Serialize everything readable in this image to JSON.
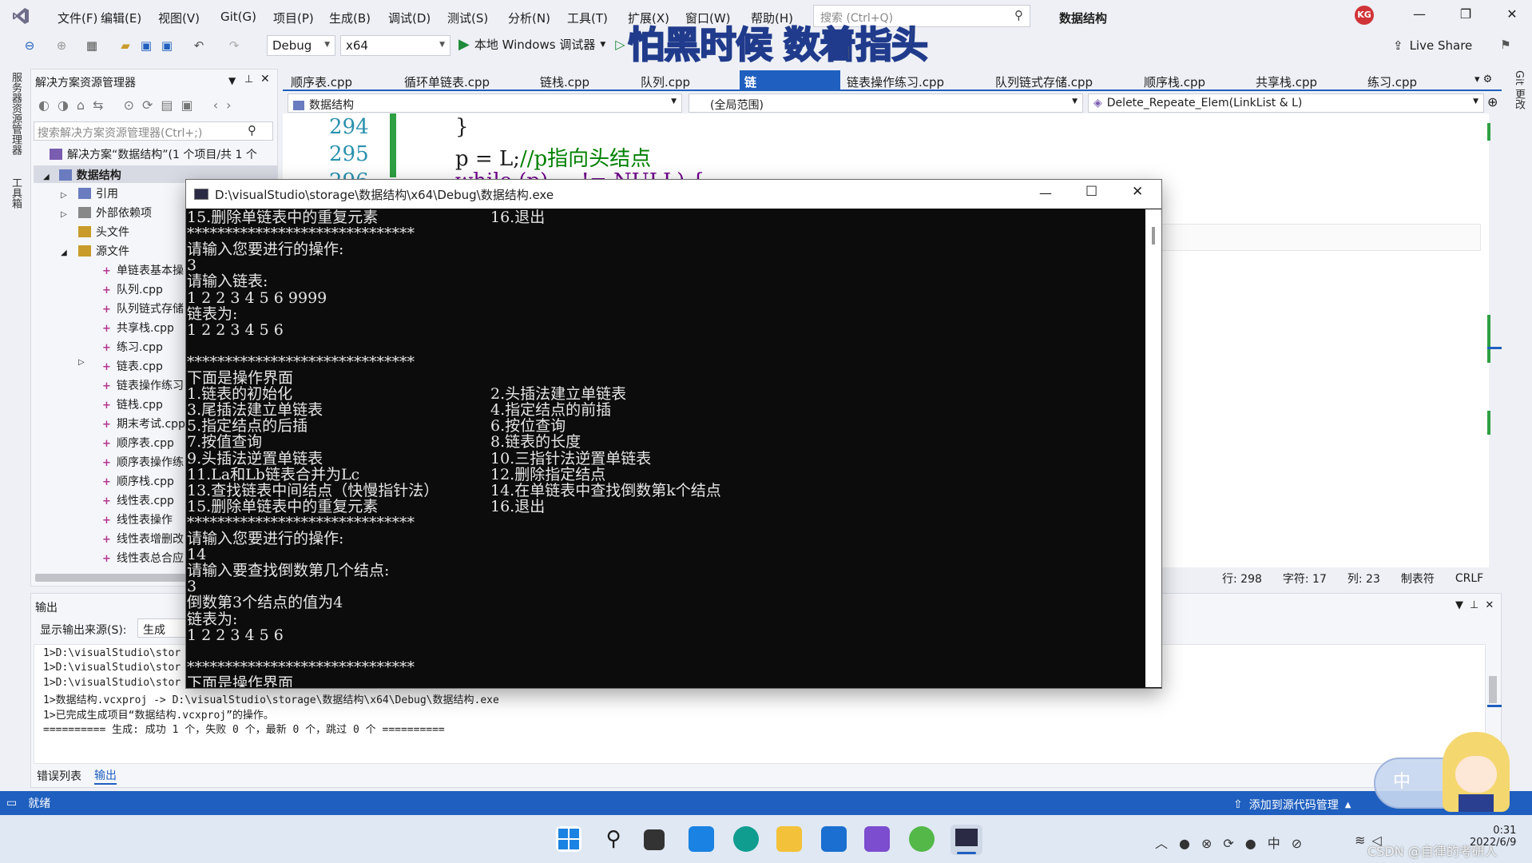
{
  "menubar": {
    "items": [
      "文件(F)",
      "编辑(E)",
      "视图(V)",
      "Git(G)",
      "项目(P)",
      "生成(B)",
      "调试(D)",
      "测试(S)",
      "分析(N)",
      "工具(T)",
      "扩展(X)",
      "窗口(W)",
      "帮助(H)"
    ],
    "search_placeholder": "搜索 (Ctrl+Q)",
    "app_title": "数据结构",
    "avatar": "KG"
  },
  "toolbar": {
    "config": "Debug",
    "platform": "x64",
    "run_label": "本地 Windows 调试器",
    "live_share": "Live Share"
  },
  "watermark": "怕黑时候 数着指头",
  "left_strip": [
    "服务器资源管理器",
    "工具箱"
  ],
  "right_strip": [
    "Git 更改"
  ],
  "solution_explorer": {
    "title": "解决方案资源管理器",
    "search_placeholder": "搜索解决方案资源管理器(Ctrl+;)",
    "solution": "解决方案“数据结构”(1 个项目/共 1 个",
    "project": "数据结构",
    "nodes": [
      "引用",
      "外部依赖项",
      "头文件",
      "源文件"
    ],
    "files": [
      "单链表基本操",
      "队列.cpp",
      "队列链式存储",
      "共享栈.cpp",
      "练习.cpp",
      "链表.cpp",
      "链表操作练习",
      "链栈.cpp",
      "期末考试.cpp",
      "顺序表.cpp",
      "顺序表操作练",
      "顺序栈.cpp",
      "线性表.cpp",
      "线性表操作",
      "线性表增删改",
      "线性表总合应"
    ]
  },
  "editor": {
    "tabs": [
      "顺序表.cpp",
      "循环单链表.cpp",
      "链栈.cpp",
      "队列.cpp",
      "链表.cpp*",
      "链表操作练习.cpp",
      "队列链式存储.cpp",
      "顺序栈.cpp",
      "共享栈.cpp",
      "练习.cpp"
    ],
    "active_tab": "链表.cpp*",
    "nav_project": "数据结构",
    "nav_scope": "(全局范围)",
    "nav_function": "Delete_Repeate_Elem(LinkList & L)",
    "line_numbers": [
      "294",
      "295",
      "296"
    ],
    "code_line_294": "}",
    "code_line_295_code": "p = L;",
    "code_line_295_comment": "//p指向头结点",
    "code_line_296": "while (p) ... != NULL) {",
    "status": {
      "line": "行: 298",
      "char": "字符: 17",
      "col": "列: 23",
      "tab": "制表符",
      "eol": "CRLF"
    }
  },
  "output_panel": {
    "title": "输出",
    "source_label": "显示输出来源(S):",
    "source_value": "生成",
    "lines": [
      "1>D:\\visualStudio\\stor",
      "1>D:\\visualStudio\\stor",
      "1>D:\\visualStudio\\stor",
      "1>数据结构.vcxproj -> D:\\visualStudio\\storage\\数据结构\\x64\\Debug\\数据结构.exe",
      "1>已完成生成项目“数据结构.vcxproj”的操作。",
      "========== 生成: 成功 1 个，失败 0 个，最新 0 个，跳过 0 个 =========="
    ],
    "bottom_tabs": [
      "错误列表",
      "输出"
    ]
  },
  "statusbar": {
    "ready": "就绪",
    "source_control": "添加到源代码管理"
  },
  "console": {
    "title": "D:\\visualStudio\\storage\\数据结构\\x64\\Debug\\数据结构.exe",
    "lines": [
      {
        "l": "15.删除单链表中的重复元素",
        "r": "16.退出"
      },
      {
        "l": "******************************"
      },
      {
        "l": "请输入您要进行的操作:"
      },
      {
        "l": "3"
      },
      {
        "l": "请输入链表:"
      },
      {
        "l": "1 2 2 3 4 5 6 9999"
      },
      {
        "l": "链表为:"
      },
      {
        "l": "1 2 2 3 4 5 6"
      },
      {
        "l": ""
      },
      {
        "l": "******************************"
      },
      {
        "l": "下面是操作界面"
      },
      {
        "l": "1.链表的初始化",
        "r": "2.头插法建立单链表"
      },
      {
        "l": "3.尾插法建立单链表",
        "r": "4.指定结点的前插"
      },
      {
        "l": "5.指定结点的后插",
        "r": "6.按位查询"
      },
      {
        "l": "7.按值查询",
        "r": "8.链表的长度"
      },
      {
        "l": "9.头插法逆置单链表",
        "r": "10.三指针法逆置单链表"
      },
      {
        "l": "11.La和Lb链表合并为Lc",
        "r": "12.删除指定结点"
      },
      {
        "l": "13.查找链表中间结点（快慢指针法）",
        "r": "14.在单链表中查找倒数第k个结点"
      },
      {
        "l": "15.删除单链表中的重复元素",
        "r": "16.退出"
      },
      {
        "l": "******************************"
      },
      {
        "l": "请输入您要进行的操作:"
      },
      {
        "l": "14"
      },
      {
        "l": "请输入要查找倒数第几个结点:"
      },
      {
        "l": "3"
      },
      {
        "l": "倒数第3个结点的值为4"
      },
      {
        "l": "链表为:"
      },
      {
        "l": "1 2 2 3 4 5 6"
      },
      {
        "l": ""
      },
      {
        "l": "******************************"
      },
      {
        "l": "下面是操作界面"
      }
    ]
  },
  "taskbar": {
    "ime_label": "中",
    "time": "0:31",
    "date": "2022/6/9",
    "csdn_watermark": "CSDN @自律的考研人"
  },
  "colors": {
    "accent": "#1f5fbf",
    "console_bg": "#0c0c0c",
    "statusbar": "#1f5fbf"
  }
}
